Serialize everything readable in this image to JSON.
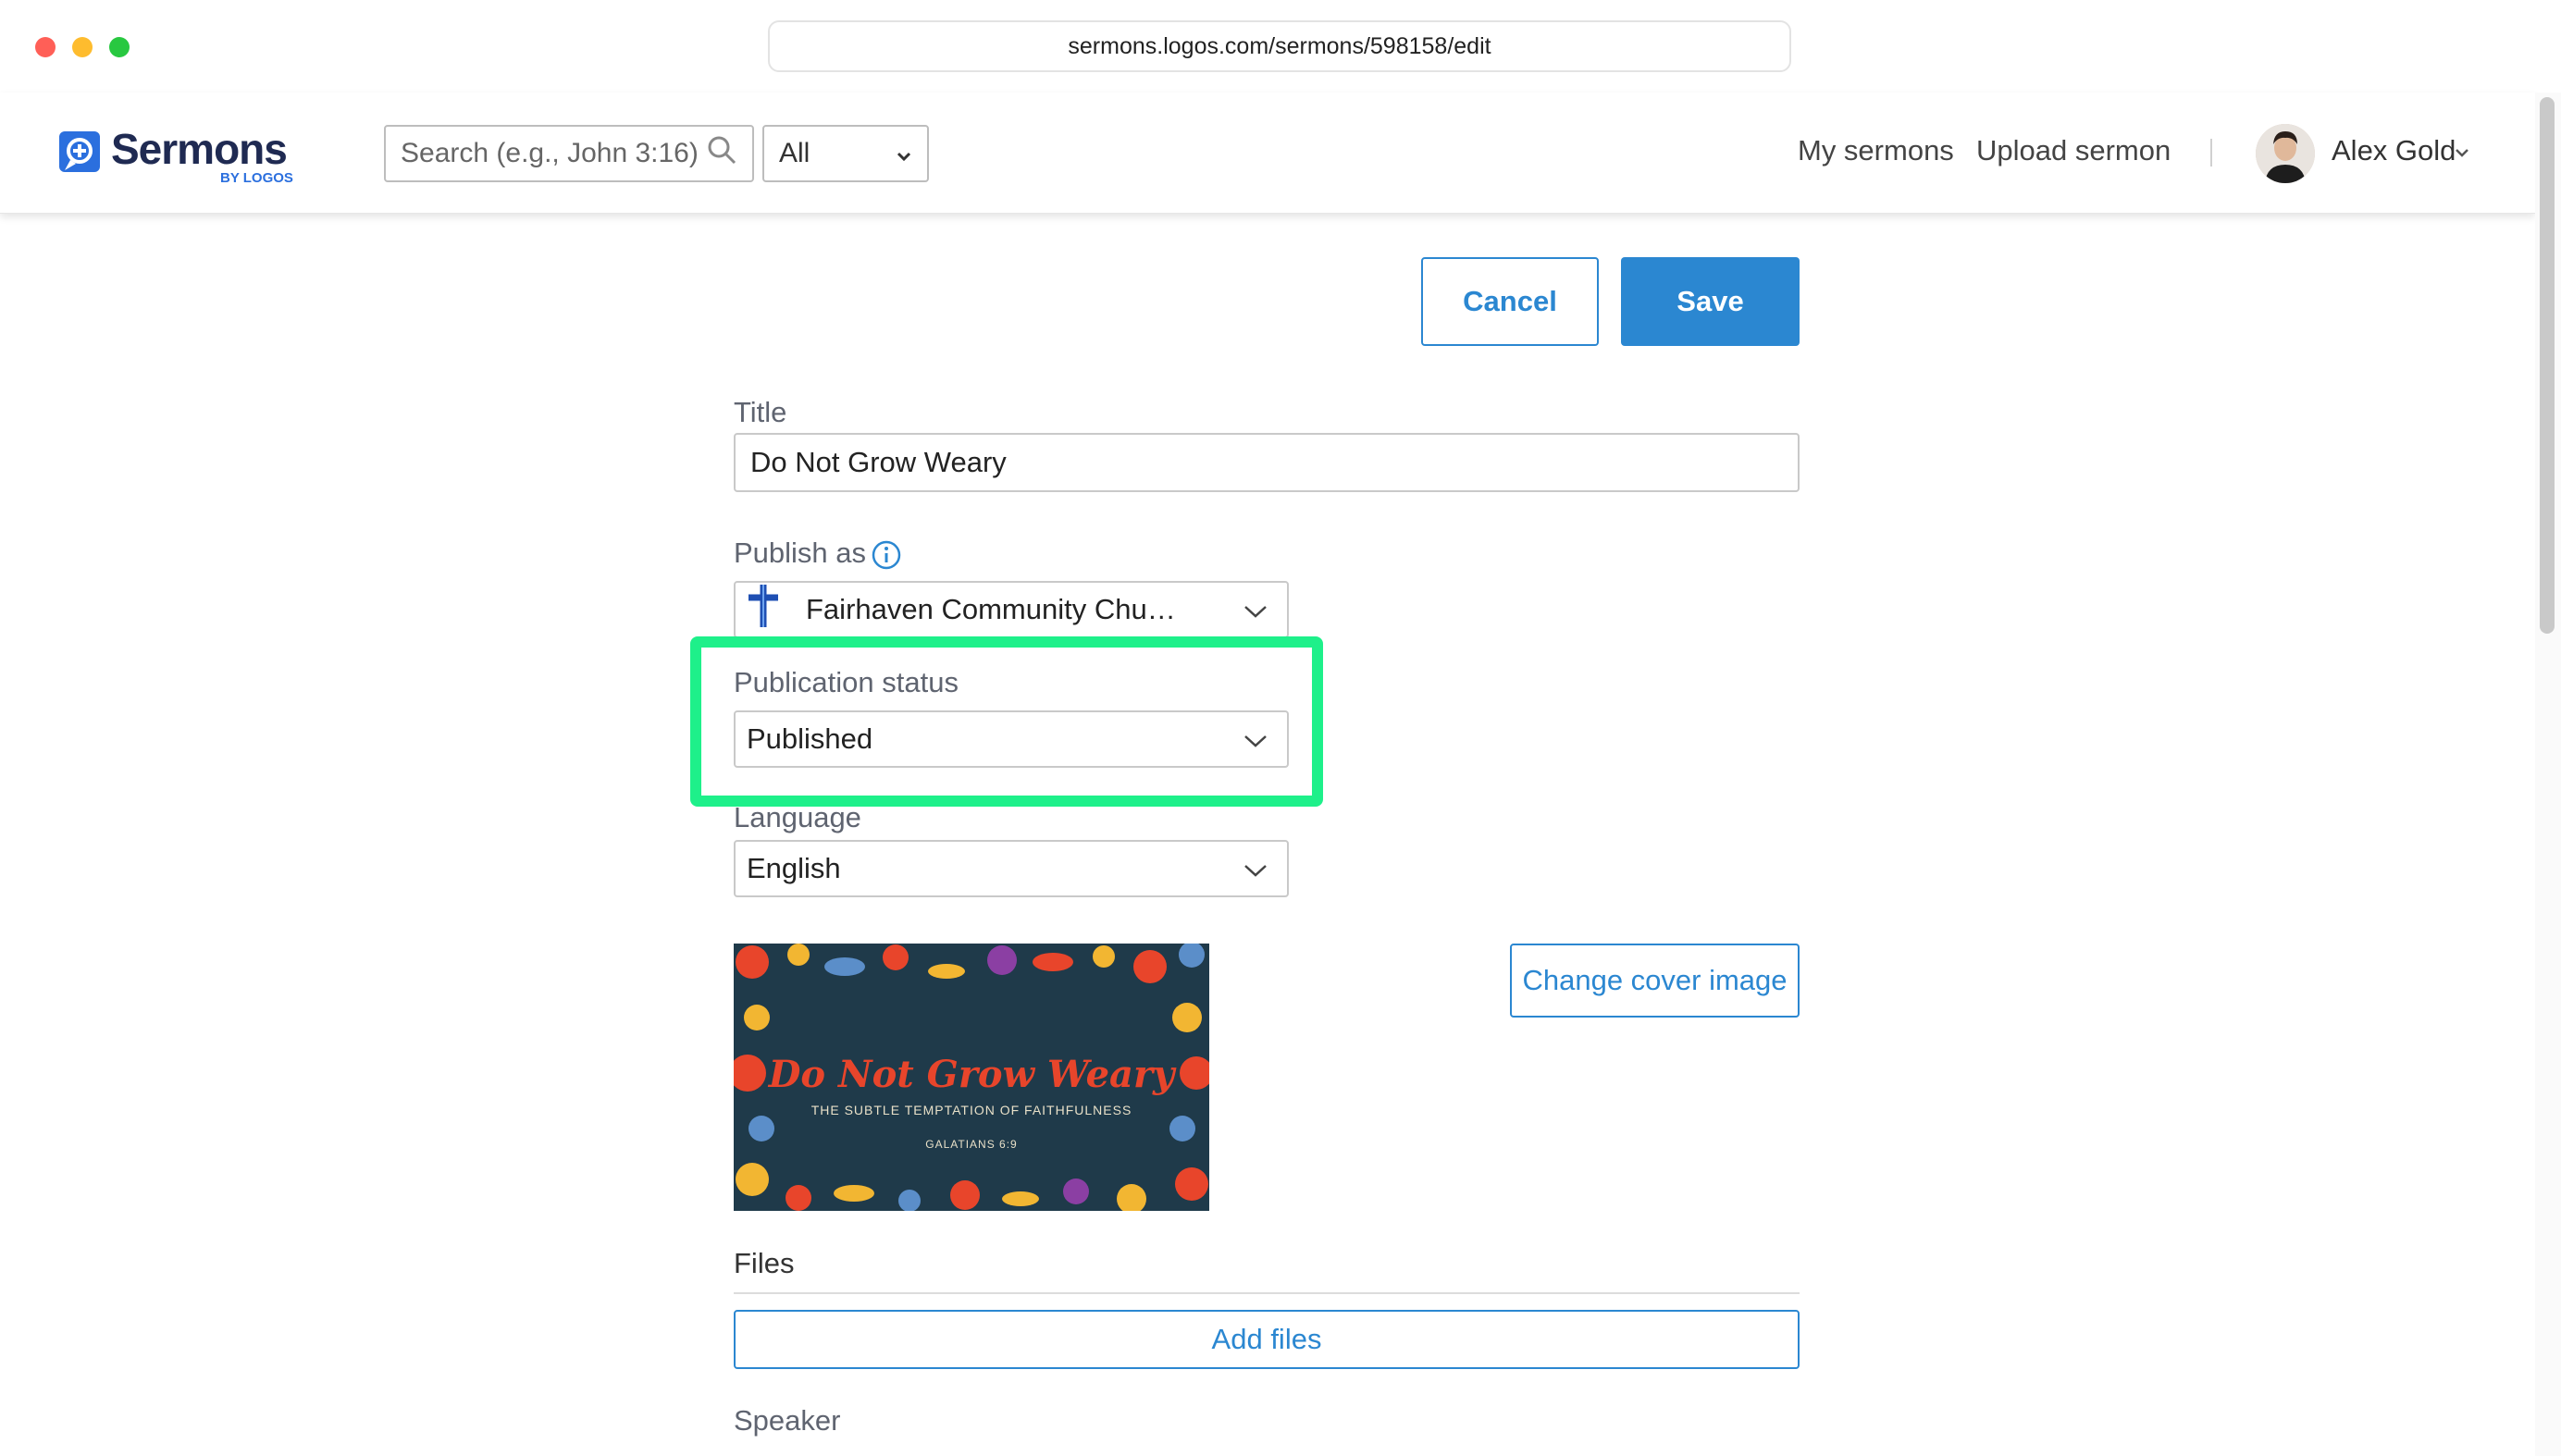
{
  "browser": {
    "url": "sermons.logos.com/sermons/598158/edit",
    "traffic_colors": [
      "#ff5f57",
      "#febc2e",
      "#28c840"
    ]
  },
  "header": {
    "logo_text": "Sermons",
    "logo_sub": "BY LOGOS",
    "search_placeholder": "Search (e.g., John 3:16)",
    "search_scope": "All",
    "nav": [
      "My sermons",
      "Upload sermon"
    ],
    "user_name": "Alex Gold"
  },
  "actions": {
    "cancel": "Cancel",
    "save": "Save"
  },
  "form": {
    "title_label": "Title",
    "title_value": "Do Not Grow Weary",
    "publish_as_label": "Publish as",
    "publish_as_value": "Fairhaven Community Chu…",
    "publication_status_label": "Publication status",
    "publication_status_value": "Published",
    "language_label": "Language",
    "language_value": "English",
    "change_cover_button": "Change cover image",
    "cover": {
      "title": "Do Not Grow Weary",
      "subtitle": "THE SUBTLE TEMPTATION OF FAITHFULNESS",
      "reference": "GALATIANS 6:9"
    },
    "files_label": "Files",
    "add_files_button": "Add files",
    "speaker_label": "Speaker"
  },
  "colors": {
    "accent": "#2b87d1",
    "highlight": "#1ef08a",
    "cover_bg": "#1f3a4a",
    "cover_title": "#e8452b"
  }
}
